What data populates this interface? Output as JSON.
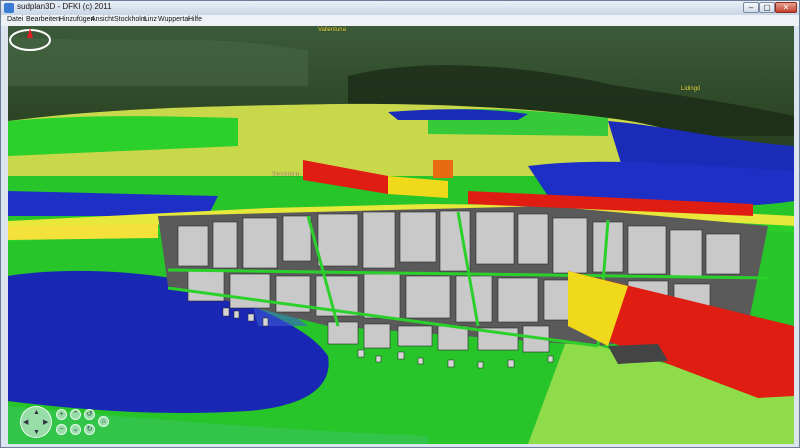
{
  "window": {
    "title": "sudplan3D - DFKI (c) 2011",
    "controls": {
      "minimize": "–",
      "maximize": "▢",
      "close": "✕"
    }
  },
  "menu": {
    "items": [
      "Datei",
      "Bearbeiten",
      "Hinzufügen",
      "Ansicht",
      "Stockholm",
      "Linz",
      "Wuppertal",
      "Hilfe"
    ]
  },
  "map": {
    "labels": {
      "vallentuna": "Vallentuna",
      "lidingo": "Lidingö",
      "stockholm": "Stockholm"
    },
    "colors": {
      "forest": "#2f4a2e",
      "low": "#1a2bb8",
      "mid_low": "#19c41f",
      "mid": "#d6e84a",
      "high": "#e81d12",
      "buildings": "#c9c9c9"
    }
  },
  "navigation": {
    "icons": [
      "pan-pad",
      "zoom-in",
      "zoom-out",
      "tilt",
      "rotate-left",
      "rotate-right",
      "reset"
    ]
  },
  "compass": {
    "icon": "compass-icon"
  }
}
